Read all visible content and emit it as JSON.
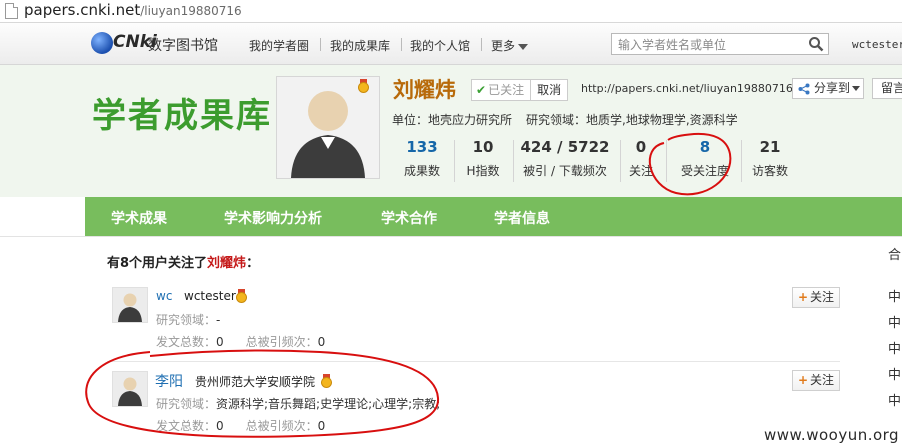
{
  "browser": {
    "url_host": "papers.cnki.net",
    "url_path": "/liuyan19880716"
  },
  "topnav": {
    "logo_text": "CNki",
    "logo_sub": "数字图书馆",
    "items": [
      "我的学者圈",
      "我的成果库",
      "我的个人馆",
      "更多"
    ],
    "search_placeholder": "输入学者姓名或单位",
    "user": "wctester"
  },
  "header": {
    "site_title": "学者成果库",
    "scholar_name": "刘耀炜",
    "followed_label": "已关注",
    "cancel_label": "取消",
    "home_url": "http://papers.cnki.net/liuyan19880716",
    "share_label": "分享到",
    "message_label": "留言",
    "unit_label": "单位：",
    "unit_value": "地壳应力研究所",
    "field_label": "研究领域：",
    "field_value": "地质学,地球物理学,资源科学",
    "stats": [
      {
        "value": "133",
        "label": "成果数"
      },
      {
        "value": "10",
        "label": "H指数"
      },
      {
        "value": "424 / 5722",
        "label": "被引 / 下载频次"
      },
      {
        "value": "0",
        "label": "关注"
      },
      {
        "value": "8",
        "label": "受关注度"
      },
      {
        "value": "21",
        "label": "访客数"
      }
    ]
  },
  "menu": [
    "学术成果",
    "学术影响力分析",
    "学术合作",
    "学者信息"
  ],
  "content": {
    "headline_prefix": "有8个用户关注了",
    "headline_name": "刘耀炜",
    "headline_suffix": "：",
    "followers": [
      {
        "short": "wc",
        "name": "wctester",
        "field_label": "研究领域：",
        "field_value": "-",
        "papers_label": "发文总数：",
        "papers_value": "0",
        "cites_label": "总被引频次：",
        "cites_value": "0",
        "follow_label": "关注"
      },
      {
        "name": "李阳",
        "institution": "贵州师范大学安顺学院",
        "field_label": "研究领域：",
        "field_value": "资源科学;音乐舞蹈;史学理论;心理学;宗教;",
        "papers_label": "发文总数：",
        "papers_value": "0",
        "cites_label": "总被引频次：",
        "cites_value": "0",
        "follow_label": "关注"
      }
    ],
    "side_header": "合",
    "side_items": [
      "中",
      "中",
      "中",
      "中",
      "中"
    ]
  },
  "watermark": "www.wooyun.org",
  "colors": {
    "brand_green": "#3c9c2e",
    "menu_green": "#78bd5d",
    "name_orange": "#b86a0a",
    "link_blue": "#1f6fb2",
    "annotation_red": "#d80f0f"
  }
}
